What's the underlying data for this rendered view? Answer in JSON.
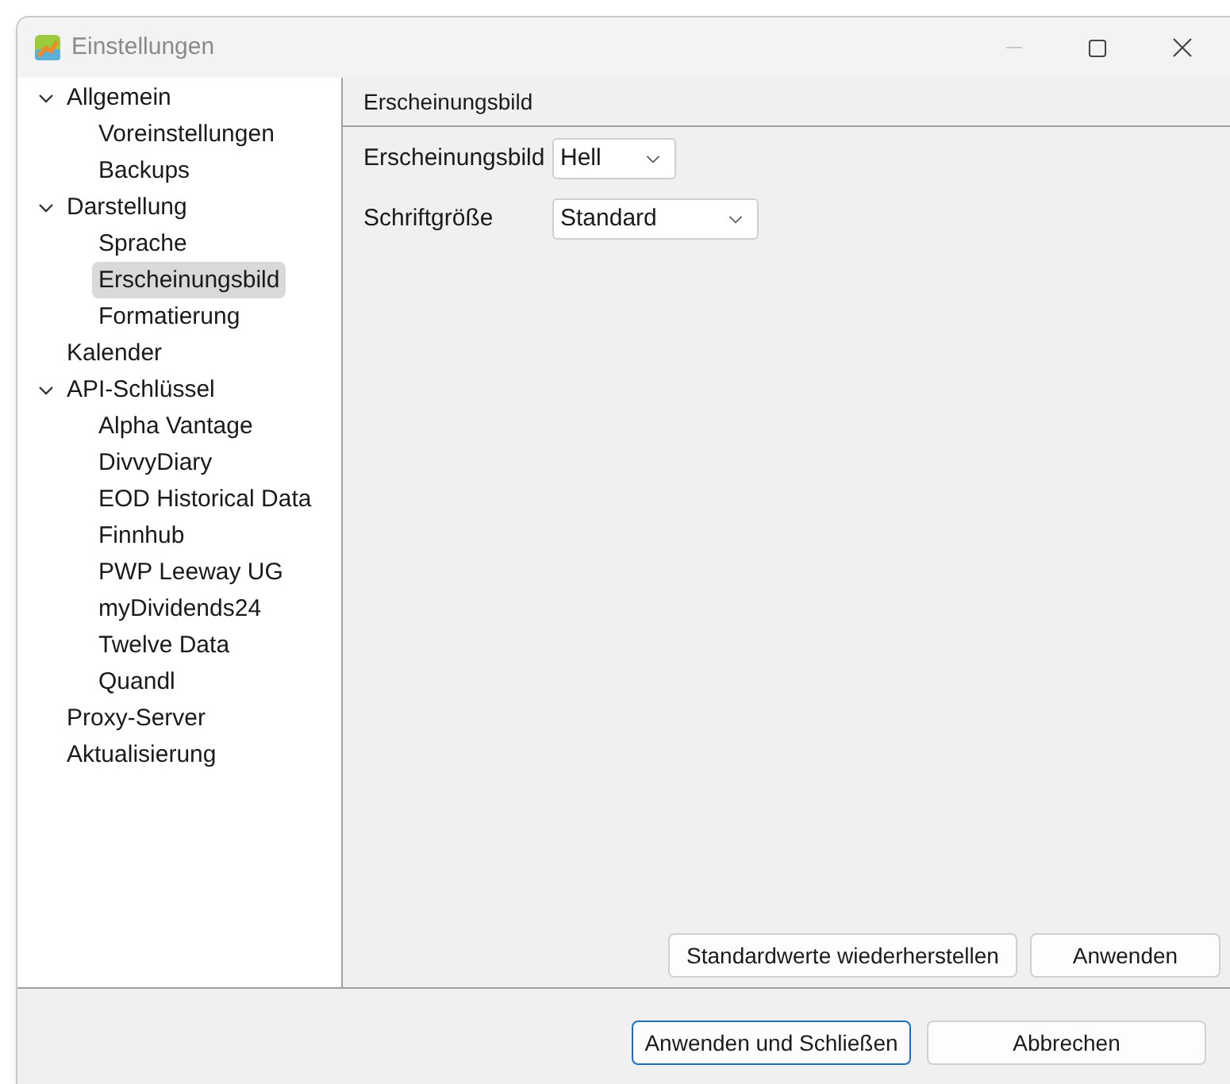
{
  "window": {
    "title": "Einstellungen"
  },
  "sidebar": {
    "items": [
      {
        "label": "Allgemein",
        "selected": false,
        "expanded": true,
        "children": [
          {
            "label": "Voreinstellungen",
            "selected": false
          },
          {
            "label": "Backups",
            "selected": false
          }
        ]
      },
      {
        "label": "Darstellung",
        "selected": false,
        "expanded": true,
        "children": [
          {
            "label": "Sprache",
            "selected": false
          },
          {
            "label": "Erscheinungsbild",
            "selected": true
          },
          {
            "label": "Formatierung",
            "selected": false
          }
        ]
      },
      {
        "label": "Kalender",
        "selected": false
      },
      {
        "label": "API-Schlüssel",
        "selected": false,
        "expanded": true,
        "children": [
          {
            "label": "Alpha Vantage",
            "selected": false
          },
          {
            "label": "DivvyDiary",
            "selected": false
          },
          {
            "label": "EOD Historical Data",
            "selected": false
          },
          {
            "label": "Finnhub",
            "selected": false
          },
          {
            "label": "PWP Leeway UG",
            "selected": false
          },
          {
            "label": "myDividends24",
            "selected": false
          },
          {
            "label": "Twelve Data",
            "selected": false
          },
          {
            "label": "Quandl",
            "selected": false
          }
        ]
      },
      {
        "label": "Proxy-Server",
        "selected": false
      },
      {
        "label": "Aktualisierung",
        "selected": false
      }
    ]
  },
  "page": {
    "title": "Erscheinungsbild",
    "fields": [
      {
        "label": "Erscheinungsbild",
        "value": "Hell",
        "kind": "dropdown"
      },
      {
        "label": "Schriftgröße",
        "value": "Standard",
        "kind": "dropdown"
      }
    ],
    "buttons": [
      {
        "label": "Standardwerte wiederherstellen"
      },
      {
        "label": "Anwenden"
      }
    ]
  },
  "footer": {
    "buttons": [
      {
        "label": "Anwenden und Schließen",
        "default": true
      },
      {
        "label": "Abbrechen",
        "default": false
      }
    ]
  }
}
